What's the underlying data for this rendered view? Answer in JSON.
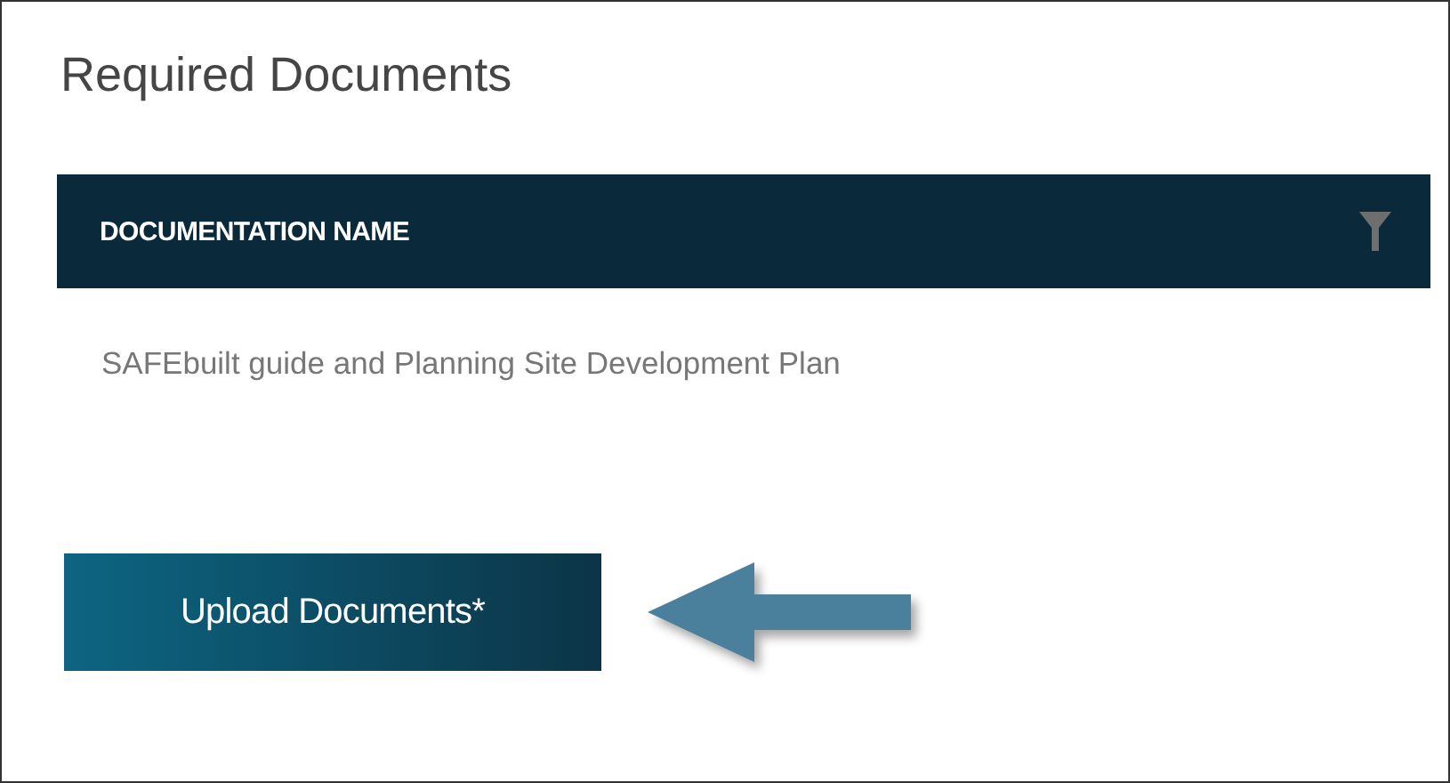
{
  "title": "Required Documents",
  "table": {
    "columns": [
      {
        "label": "DOCUMENTATION NAME"
      }
    ],
    "rows": [
      [
        "SAFEbuilt guide and Planning Site Development Plan"
      ]
    ]
  },
  "upload_button": {
    "label": "Upload Documents*"
  }
}
